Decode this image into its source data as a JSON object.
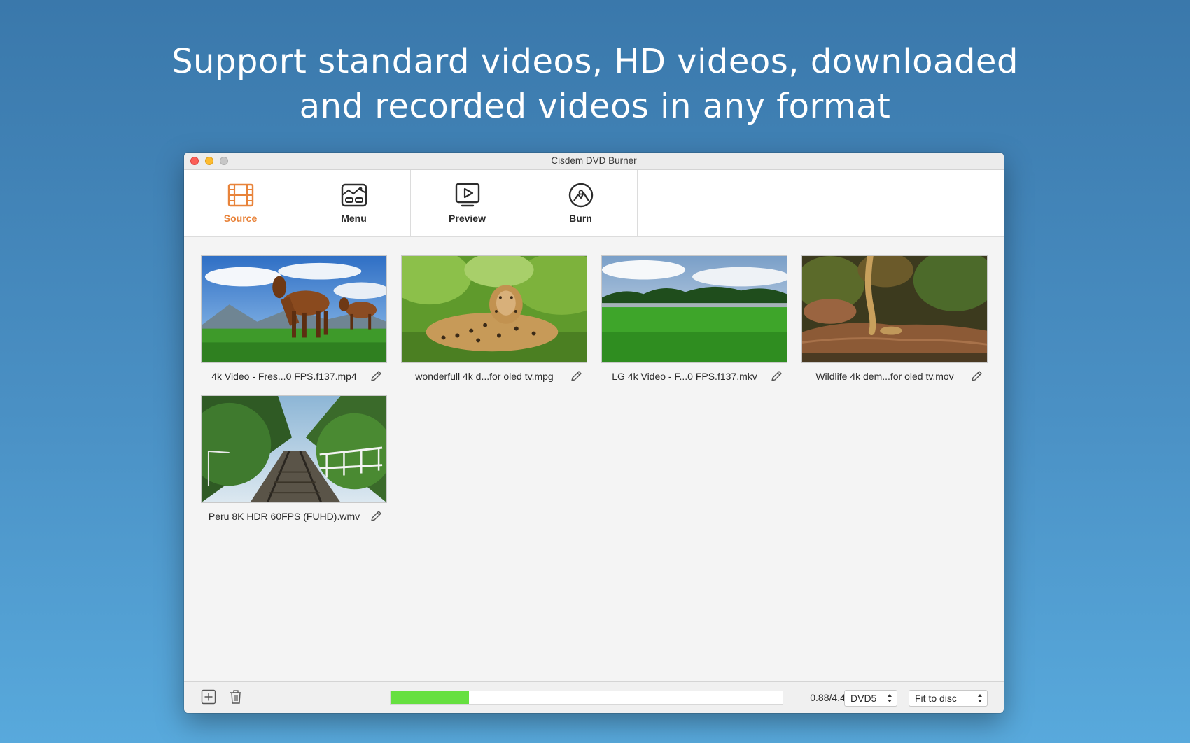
{
  "headline": {
    "line1": "Support standard videos, HD videos, downloaded",
    "line2": "and recorded videos in any format"
  },
  "window": {
    "title": "Cisdem DVD Burner"
  },
  "toolbar": {
    "tabs": [
      {
        "label": "Source",
        "icon": "film-strip-icon",
        "active": true
      },
      {
        "label": "Menu",
        "icon": "menu-template-icon",
        "active": false
      },
      {
        "label": "Preview",
        "icon": "preview-play-icon",
        "active": false
      },
      {
        "label": "Burn",
        "icon": "disc-burn-icon",
        "active": false
      }
    ]
  },
  "videos": [
    {
      "name": "4k Video - Fres...0 FPS.f137.mp4",
      "scene": "horses on meadow"
    },
    {
      "name": "wonderfull 4k d...for oled tv.mpg",
      "scene": "leopard in grass"
    },
    {
      "name": "LG 4k Video - F...0 FPS.f137.mkv",
      "scene": "green field and forest"
    },
    {
      "name": "Wildlife 4k dem...for oled tv.mov",
      "scene": "snake on log"
    },
    {
      "name": "Peru 8K HDR 60FPS (FUHD).wmv",
      "scene": "railway through jungle"
    }
  ],
  "bottombar": {
    "capacity_fraction": 0.2,
    "size_text": "0.88/4.4G",
    "disc_type": "DVD5",
    "quality_mode": "Fit to disc"
  },
  "colors": {
    "accent_orange": "#e8833a",
    "capacity_green": "#66e040"
  }
}
